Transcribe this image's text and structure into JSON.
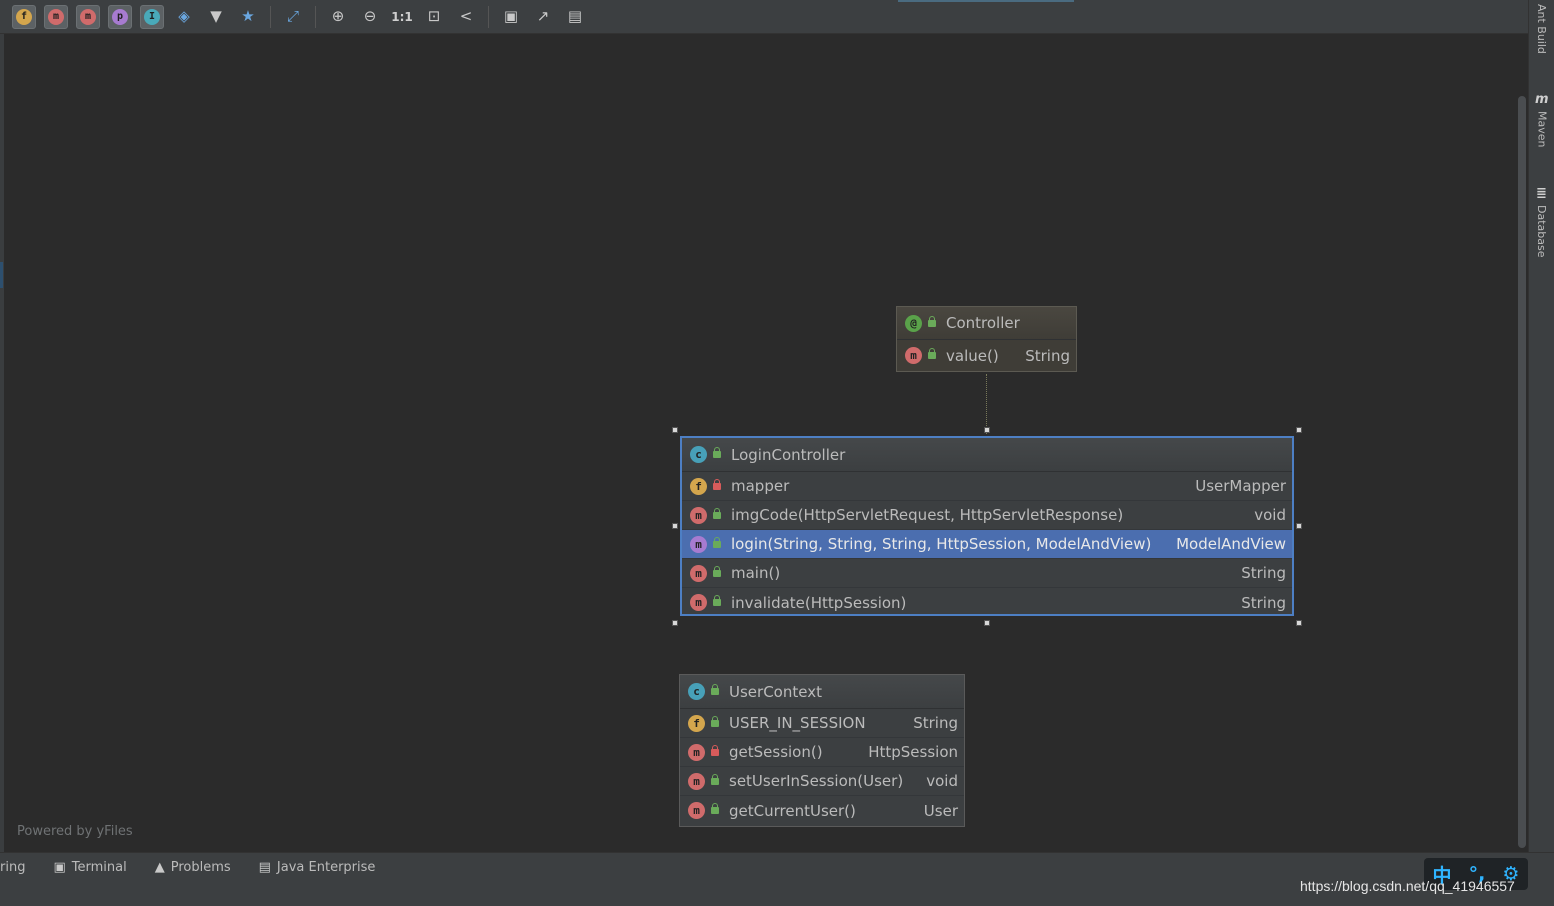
{
  "toolbar": {
    "badges": [
      {
        "letter": "f",
        "name": "fields"
      },
      {
        "letter": "m",
        "name": "constructors"
      },
      {
        "letter": "m",
        "name": "methods"
      },
      {
        "letter": "p",
        "name": "properties"
      },
      {
        "letter": "I",
        "name": "inner-classes"
      }
    ],
    "zoom_actual_label": "1:1"
  },
  "right_tabs": [
    "Ant Build",
    "Maven",
    "Database"
  ],
  "canvas": {
    "powered_by": "Powered by yFiles"
  },
  "nodes": {
    "controller": {
      "title": "Controller",
      "title_icon": "@",
      "rows": [
        {
          "icon": "m",
          "name": "value()",
          "type": "String"
        }
      ]
    },
    "login_controller": {
      "title": "LoginController",
      "title_icon": "c",
      "rows": [
        {
          "icon": "f",
          "name": "mapper",
          "type": "UserMapper"
        },
        {
          "icon": "m",
          "name": "imgCode(HttpServletRequest, HttpServletResponse)",
          "type": "void"
        },
        {
          "icon": "m",
          "name": "login(String, String, String, HttpSession, ModelAndView)",
          "type": "ModelAndView"
        },
        {
          "icon": "m",
          "name": "main()",
          "type": "String"
        },
        {
          "icon": "m",
          "name": "invalidate(HttpSession)",
          "type": "String"
        }
      ]
    },
    "user_context": {
      "title": "UserContext",
      "title_icon": "c",
      "rows": [
        {
          "icon": "f",
          "name": "USER_IN_SESSION",
          "type": "String"
        },
        {
          "icon": "m",
          "name": "getSession()",
          "type": "HttpSession"
        },
        {
          "icon": "m",
          "name": "setUserInSession(User)",
          "type": "void"
        },
        {
          "icon": "m",
          "name": "getCurrentUser()",
          "type": "User"
        }
      ]
    }
  },
  "bottom_tabs": [
    "ring",
    "Terminal",
    "Problems",
    "Java Enterprise"
  ],
  "watermark": "https://blog.csdn.net/qq_41946557",
  "ime": [
    "中",
    "°,",
    "⚙"
  ]
}
